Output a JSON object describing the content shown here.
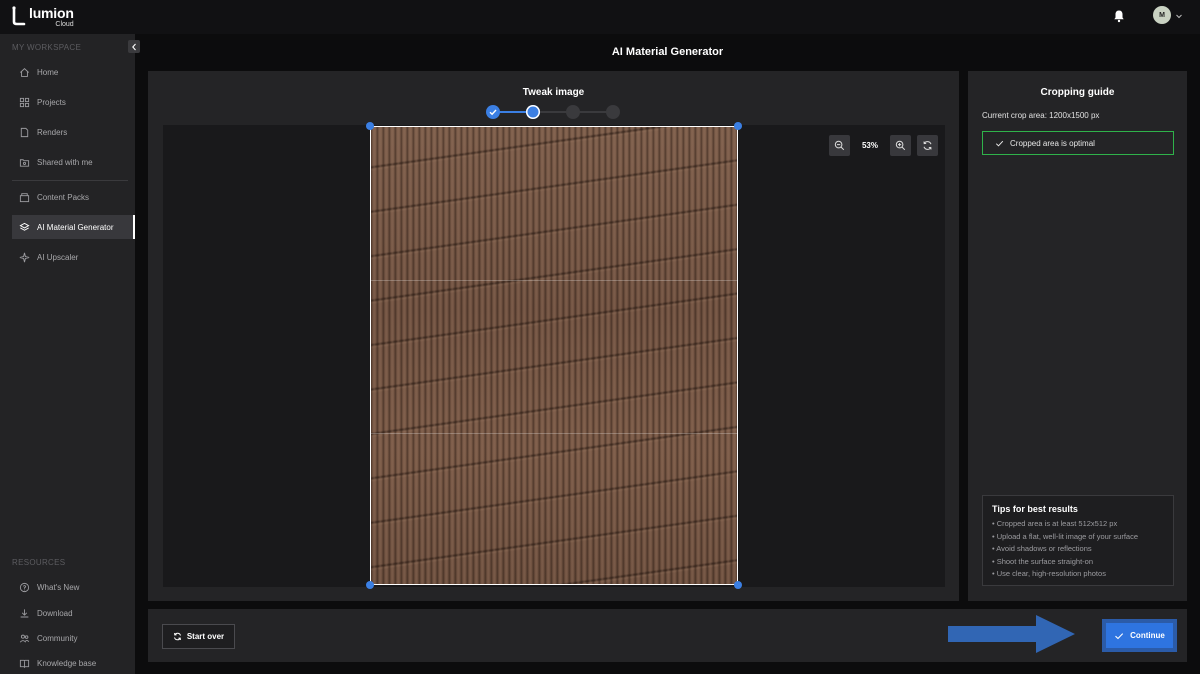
{
  "app": {
    "name": "lumion",
    "sub": "Cloud"
  },
  "user": {
    "initial": "M"
  },
  "sidebar": {
    "workspace_label": "MY WORKSPACE",
    "resources_label": "RESOURCES",
    "items": [
      {
        "label": "Home",
        "icon": "home-icon"
      },
      {
        "label": "Projects",
        "icon": "grid-icon"
      },
      {
        "label": "Renders",
        "icon": "file-icon"
      },
      {
        "label": "Shared with me",
        "icon": "shared-folder-icon"
      },
      {
        "label": "Content Packs",
        "icon": "boxes-icon"
      },
      {
        "label": "AI Material Generator",
        "icon": "layers-icon"
      },
      {
        "label": "AI Upscaler",
        "icon": "sparkle-icon"
      }
    ],
    "resources": [
      {
        "label": "What's New",
        "icon": "help-circle-icon"
      },
      {
        "label": "Download",
        "icon": "download-icon"
      },
      {
        "label": "Community",
        "icon": "people-icon"
      },
      {
        "label": "Knowledge base",
        "icon": "book-icon"
      }
    ]
  },
  "page": {
    "title": "AI Material Generator"
  },
  "editor": {
    "step_title": "Tweak image",
    "zoom": "53%"
  },
  "guide": {
    "title": "Cropping guide",
    "crop_area": "Current crop area: 1200x1500 px",
    "status": "Cropped area is optimal",
    "tips_title": "Tips for best results",
    "tips": [
      "• Cropped area is at least 512x512 px",
      "• Upload a flat, well-lit image of your surface",
      "• Avoid shadows or reflections",
      "• Shoot the surface straight-on",
      "• Use clear, high-resolution photos"
    ]
  },
  "footer": {
    "start_over": "Start over",
    "continue": "Continue"
  },
  "colors": {
    "accent": "#2e74e0",
    "success": "#2fb24a",
    "panel": "#242426"
  }
}
